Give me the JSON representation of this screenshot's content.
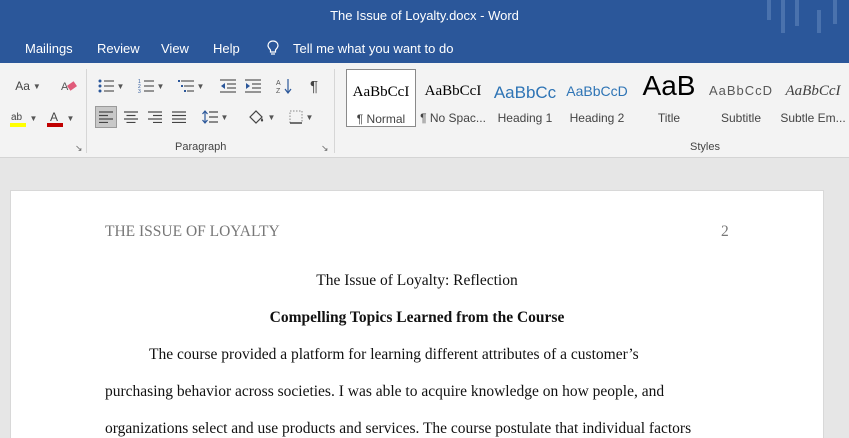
{
  "window": {
    "title": "The Issue of Loyalty.docx  -  Word"
  },
  "menu": {
    "tabs": [
      "Mailings",
      "Review",
      "View",
      "Help"
    ],
    "tell_me": "Tell me what you want to do"
  },
  "ribbon": {
    "font_group": {
      "change_case": "Aa",
      "clear_formatting_icon": "eraser-icon",
      "highlight_icon": "highlighter-icon",
      "highlight_color": "#ffff00",
      "font_color_icon": "font-color-icon",
      "font_color": "#c00000"
    },
    "paragraph_group": {
      "label": "Paragraph"
    },
    "styles_group": {
      "label": "Styles",
      "items": [
        {
          "sample": "AaBbCcI",
          "name": "¶ Normal",
          "color": "#000000"
        },
        {
          "sample": "AaBbCcI",
          "name": "¶ No Spac...",
          "color": "#000000"
        },
        {
          "sample": "AaBbCc",
          "name": "Heading 1",
          "color": "#2e74b5"
        },
        {
          "sample": "AaBbCcD",
          "name": "Heading 2",
          "color": "#2e74b5"
        },
        {
          "sample": "AaB",
          "name": "Title",
          "color": "#000000"
        },
        {
          "sample": "AaBbCcD",
          "name": "Subtitle",
          "color": "#595959"
        },
        {
          "sample": "AaBbCcI",
          "name": "Subtle Em...",
          "color": "#404040"
        }
      ]
    }
  },
  "document": {
    "running_head": "THE ISSUE OF LOYALTY",
    "page_number": "2",
    "title": "The Issue of Loyalty: Reflection",
    "heading": "Compelling Topics Learned from the Course",
    "lines": [
      "The course provided a platform for learning different attributes of a customer’s",
      "purchasing behavior across societies. I was able to acquire knowledge on how people, and",
      "organizations select and use products and services. The course postulate that individual factors"
    ]
  }
}
